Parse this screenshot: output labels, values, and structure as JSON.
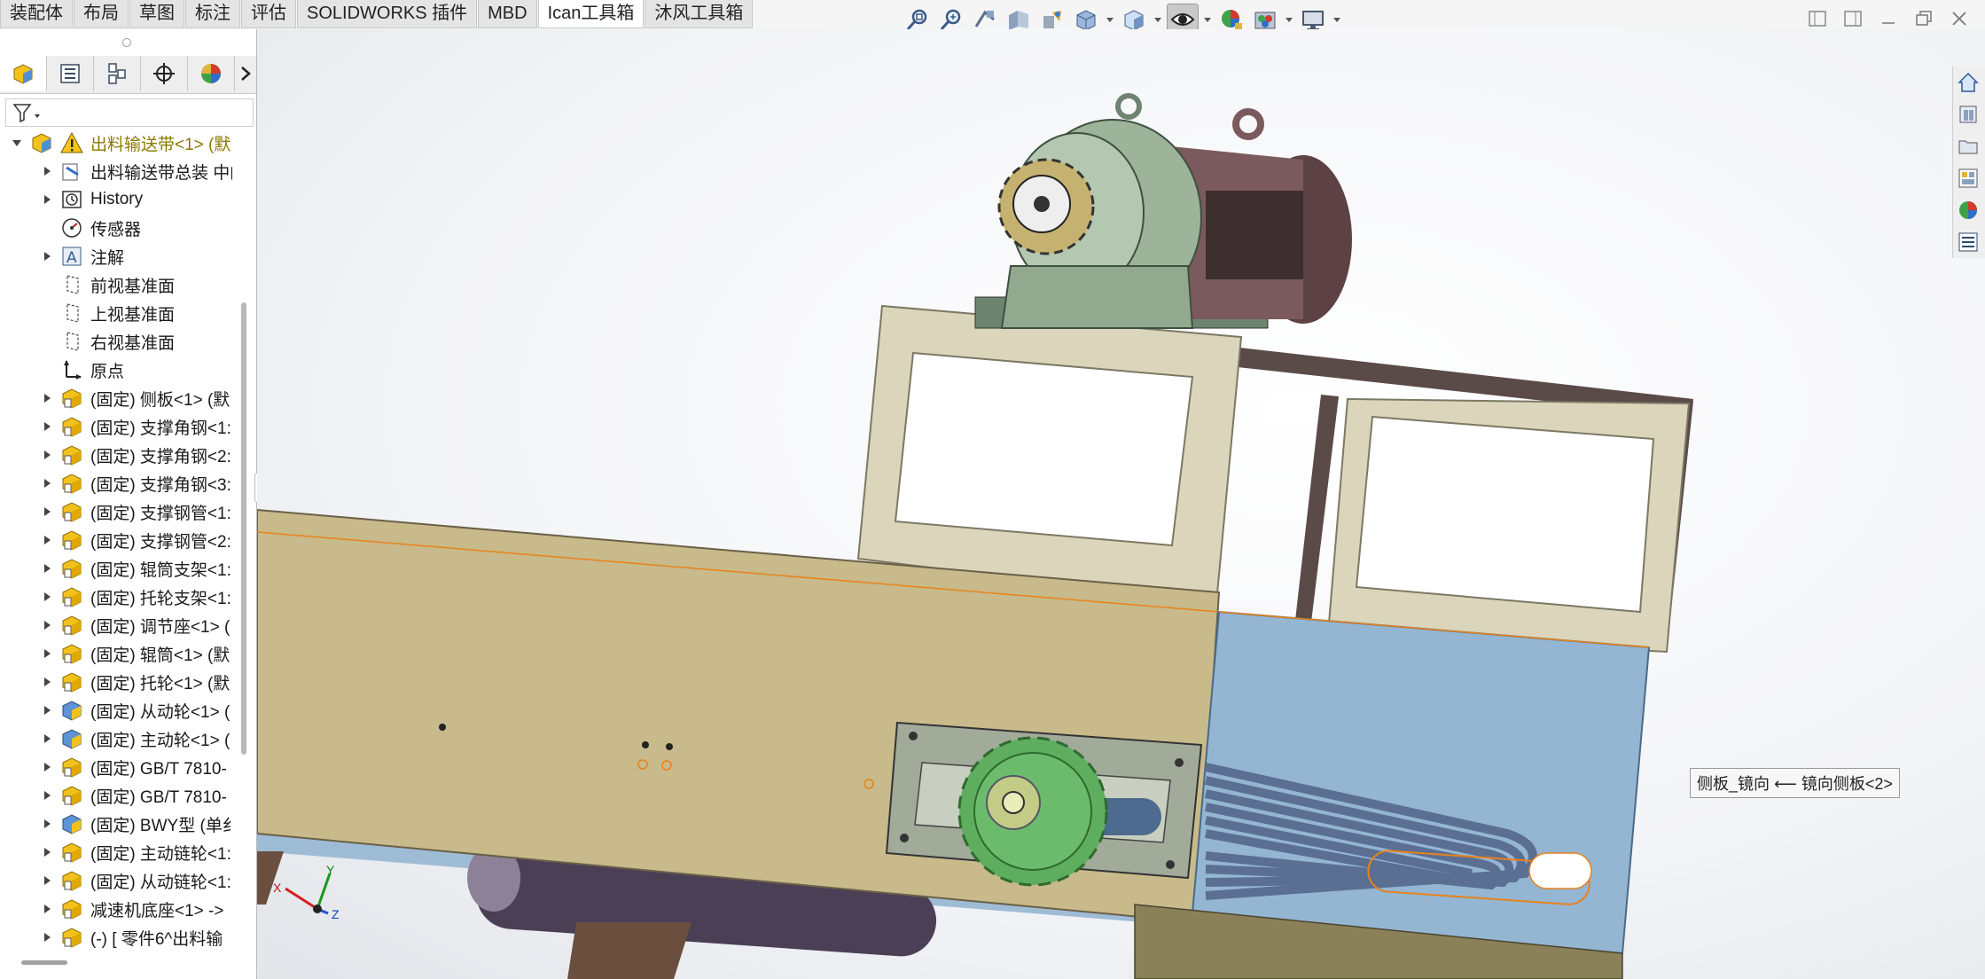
{
  "tabs": [
    "装配体",
    "布局",
    "草图",
    "标注",
    "评估",
    "SOLIDWORKS 插件",
    "MBD",
    "Ican工具箱",
    "沐风工具箱"
  ],
  "active_tab_index": 7,
  "hud_icons": [
    "zoom-to-fit-icon",
    "zoom-to-area-icon",
    "previous-view-icon",
    "section-view-icon",
    "dynamic-annotation-icon",
    "view-orientation-icon",
    "display-style-icon",
    "hide-show-items-icon",
    "edit-appearance-icon",
    "apply-scene-icon",
    "view-settings-icon"
  ],
  "window_controls": [
    "tile-left-icon",
    "tile-right-icon",
    "minimize-icon",
    "restore-icon",
    "close-icon"
  ],
  "panel_tabs": [
    "featuremanager-icon",
    "propertymanager-icon",
    "configurationmanager-icon",
    "dimxpertmanager-icon",
    "displaymanager-icon"
  ],
  "tree": {
    "root": "出料输送带<1> (默",
    "items": [
      {
        "label": "出料输送带总装 中的",
        "icon": "folder-icon",
        "expand": true
      },
      {
        "label": "History",
        "icon": "history-icon",
        "expand": true
      },
      {
        "label": "传感器",
        "icon": "sensor-icon",
        "expand": false
      },
      {
        "label": "注解",
        "icon": "annotation-icon",
        "expand": true
      },
      {
        "label": "前视基准面",
        "icon": "plane-icon",
        "expand": false
      },
      {
        "label": "上视基准面",
        "icon": "plane-icon",
        "expand": false
      },
      {
        "label": "右视基准面",
        "icon": "plane-icon",
        "expand": false
      },
      {
        "label": "原点",
        "icon": "origin-icon",
        "expand": false
      },
      {
        "label": "(固定) 侧板<1> (默",
        "icon": "part-icon",
        "expand": true
      },
      {
        "label": "(固定) 支撑角钢<1:",
        "icon": "part-icon",
        "expand": true
      },
      {
        "label": "(固定) 支撑角钢<2:",
        "icon": "part-icon",
        "expand": true
      },
      {
        "label": "(固定) 支撑角钢<3:",
        "icon": "part-icon",
        "expand": true
      },
      {
        "label": "(固定) 支撑钢管<1:",
        "icon": "part-icon",
        "expand": true
      },
      {
        "label": "(固定) 支撑钢管<2:",
        "icon": "part-icon",
        "expand": true
      },
      {
        "label": "(固定) 辊筒支架<1:",
        "icon": "part-icon",
        "expand": true
      },
      {
        "label": "(固定) 托轮支架<1:",
        "icon": "part-icon",
        "expand": true
      },
      {
        "label": "(固定) 调节座<1> (",
        "icon": "part-icon",
        "expand": true
      },
      {
        "label": "(固定) 辊筒<1> (默",
        "icon": "part-icon",
        "expand": true
      },
      {
        "label": "(固定) 托轮<1> (默",
        "icon": "part-icon",
        "expand": true
      },
      {
        "label": "(固定) 从动轮<1> (",
        "icon": "part-blue-icon",
        "expand": true
      },
      {
        "label": "(固定) 主动轮<1> (",
        "icon": "part-blue-icon",
        "expand": true
      },
      {
        "label": "(固定) GB/T 7810-",
        "icon": "part-icon",
        "expand": true
      },
      {
        "label": "(固定) GB/T 7810-",
        "icon": "part-icon",
        "expand": true
      },
      {
        "label": "(固定) BWY型 (单纟",
        "icon": "part-blue-icon",
        "expand": true
      },
      {
        "label": "(固定) 主动链轮<1:",
        "icon": "part-icon",
        "expand": true
      },
      {
        "label": "(固定) 从动链轮<1:",
        "icon": "part-icon",
        "expand": true
      },
      {
        "label": "减速机底座<1> ->",
        "icon": "part-icon",
        "expand": true
      },
      {
        "label": "(-) [ 零件6^出料输",
        "icon": "part-icon",
        "expand": true
      }
    ]
  },
  "viewport": {
    "callout": "侧板_镜向 ⟵ 镜向侧板<2>",
    "triad": {
      "x": "X",
      "y": "Y",
      "z": "Z"
    }
  },
  "taskpane_icons": [
    "solidworks-resources-icon",
    "design-library-icon",
    "file-explorer-icon",
    "view-palette-icon",
    "appearances-icon",
    "custom-properties-icon"
  ],
  "colors": {
    "accent_orange": "#e8821c",
    "root_label": "#8a7a00",
    "side_plate": "#c8ba8a",
    "guard_blue": "#94b6d2",
    "frame_brown": "#5a4a48",
    "frame_cream": "#dbd6bb",
    "sprocket_green": "#5fae5f",
    "reducer_green": "#9db39a"
  }
}
